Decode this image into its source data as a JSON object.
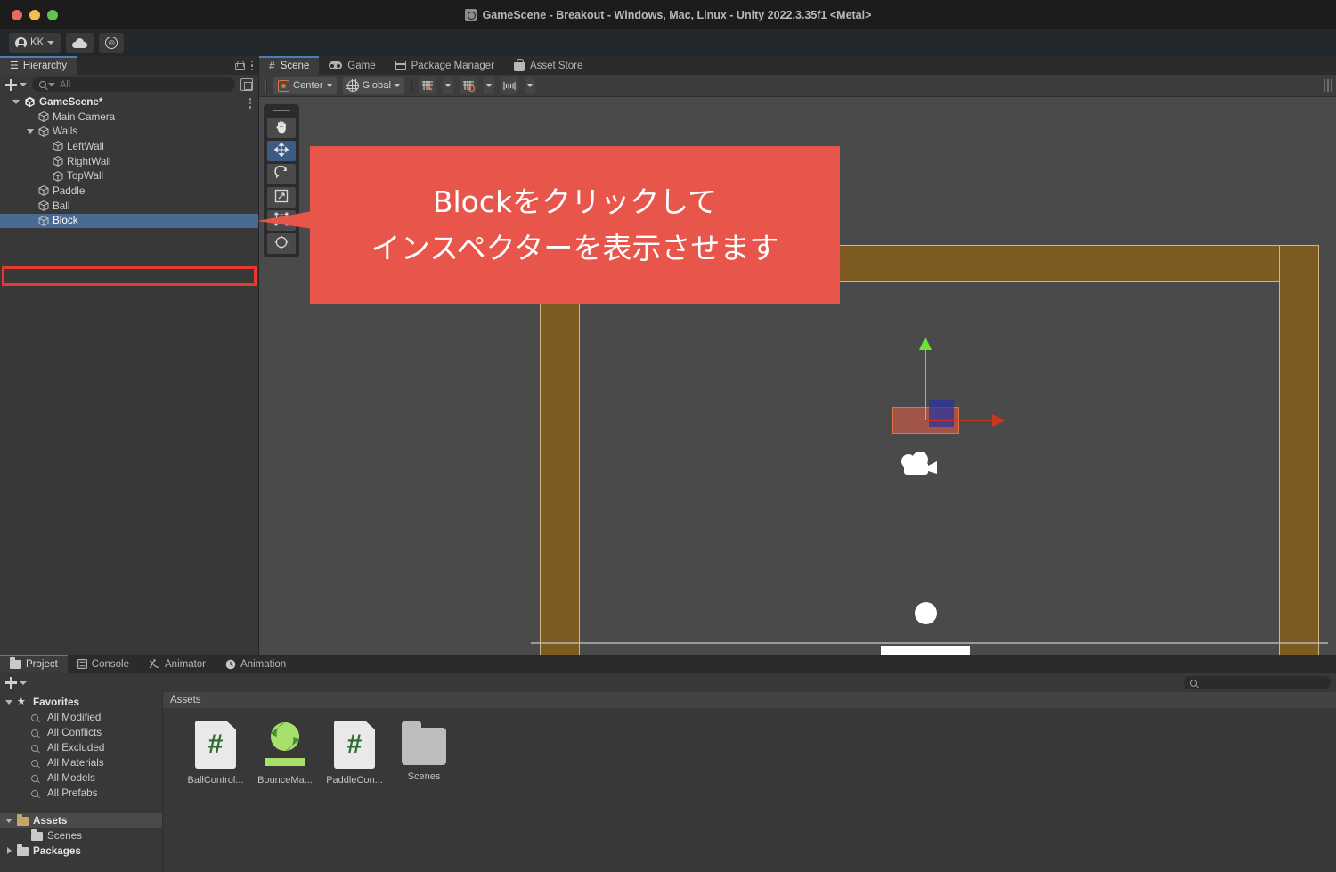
{
  "window": {
    "title": "GameScene - Breakout - Windows, Mac, Linux - Unity 2022.3.35f1 <Metal>",
    "title_icon": "unity-scene-icon",
    "traffic_lights": [
      "close",
      "minimize",
      "maximize"
    ]
  },
  "toolbar": {
    "account_label": "KK",
    "account_icon": "person-icon",
    "cloud_icon": "cloud-icon",
    "services_icon": "unity-services-icon",
    "services_glyph": "◎",
    "play_label": "play-icon",
    "pause_label": "pause-icon",
    "step_label": "step-icon"
  },
  "hierarchy": {
    "tab_label": "Hierarchy",
    "tab_icon": "hierarchy-icon",
    "lock_icon": "lock-icon",
    "menu_icon": "kebab-menu-icon",
    "add_label": "+",
    "search_placeholder": "All",
    "search_value": "",
    "search_icon": "search-icon",
    "popout_icon": "popout-icon",
    "items": [
      {
        "label": "GameScene*",
        "depth": 0,
        "expanded": true,
        "icon": "unity-logo-icon",
        "selected": false
      },
      {
        "label": "Main Camera",
        "depth": 1,
        "expanded": null,
        "icon": "gameobject-cube-icon",
        "selected": false
      },
      {
        "label": "Walls",
        "depth": 1,
        "expanded": true,
        "icon": "gameobject-cube-icon",
        "selected": false
      },
      {
        "label": "LeftWall",
        "depth": 2,
        "expanded": null,
        "icon": "gameobject-cube-icon",
        "selected": false
      },
      {
        "label": "RightWall",
        "depth": 2,
        "expanded": null,
        "icon": "gameobject-cube-icon",
        "selected": false
      },
      {
        "label": "TopWall",
        "depth": 2,
        "expanded": null,
        "icon": "gameobject-cube-icon",
        "selected": false
      },
      {
        "label": "Paddle",
        "depth": 1,
        "expanded": null,
        "icon": "gameobject-cube-icon",
        "selected": false
      },
      {
        "label": "Ball",
        "depth": 1,
        "expanded": null,
        "icon": "gameobject-cube-icon",
        "selected": false
      },
      {
        "label": "Block",
        "depth": 1,
        "expanded": null,
        "icon": "gameobject-cube-icon",
        "selected": true
      }
    ]
  },
  "scene": {
    "tabs": [
      {
        "label": "Scene",
        "icon": "grid-hash-icon",
        "active": true
      },
      {
        "label": "Game",
        "icon": "gamepad-icon",
        "active": false
      },
      {
        "label": "Package Manager",
        "icon": "package-icon",
        "active": false
      },
      {
        "label": "Asset Store",
        "icon": "store-bag-icon",
        "active": false
      }
    ],
    "toolbar": {
      "pivot_label": "Center",
      "pivot_icon": "pivot-center-icon",
      "handle_label": "Global",
      "handle_icon": "globe-icon",
      "grid_snap_icon": "grid-snap-icon",
      "snap_increment_icon": "snap-increment-icon",
      "align_icon": "align-icon",
      "dropdown_icon": "chevron-down-icon",
      "resize_handle_icon": "resize-handle-icon"
    },
    "tools": [
      {
        "name": "hand-tool",
        "icon": "hand-icon",
        "active": false
      },
      {
        "name": "move-tool",
        "icon": "move-arrows-icon",
        "active": true
      },
      {
        "name": "rotate-tool",
        "icon": "rotate-icon",
        "active": false
      },
      {
        "name": "scale-tool",
        "icon": "scale-icon",
        "active": false
      },
      {
        "name": "rect-tool",
        "icon": "rect-transform-icon",
        "active": false
      },
      {
        "name": "transform-tool",
        "icon": "transform-icon",
        "active": false
      }
    ],
    "objects": {
      "wall_color": "#7c5a20",
      "wall_outline": "#cbb98a",
      "ball_color": "#ffffff",
      "paddle_color": "#ffffff",
      "block_fill": "#d65e48",
      "block_outline": "#e2743f",
      "gizmo_y_color": "#6ee03a",
      "gizmo_x_color": "#c9361f",
      "camera_gizmo_icon": "camera-gizmo-icon",
      "background": "#4a4a4a"
    }
  },
  "callout": {
    "line1": "Blockをクリックして",
    "line2": "インスペクターを表示させます",
    "background": "#e8564b",
    "text_color": "#ffffff",
    "highlight_color": "#e8372c"
  },
  "project": {
    "tabs": [
      {
        "label": "Project",
        "icon": "folder-icon",
        "active": true
      },
      {
        "label": "Console",
        "icon": "console-icon",
        "active": false
      },
      {
        "label": "Animator",
        "icon": "animator-icon",
        "active": false
      },
      {
        "label": "Animation",
        "icon": "animation-clock-icon",
        "active": false
      }
    ],
    "add_label": "+",
    "search_placeholder": "",
    "search_value": "",
    "search_icon": "search-icon",
    "tree": [
      {
        "label": "Favorites",
        "depth": 0,
        "icon": "star-icon",
        "expanded": true,
        "bold": true,
        "highlight": false
      },
      {
        "label": "All Modified",
        "depth": 1,
        "icon": "search-icon",
        "expanded": null,
        "bold": false,
        "highlight": false
      },
      {
        "label": "All Conflicts",
        "depth": 1,
        "icon": "search-icon",
        "expanded": null,
        "bold": false,
        "highlight": false
      },
      {
        "label": "All Excluded",
        "depth": 1,
        "icon": "search-icon",
        "expanded": null,
        "bold": false,
        "highlight": false
      },
      {
        "label": "All Materials",
        "depth": 1,
        "icon": "search-icon",
        "expanded": null,
        "bold": false,
        "highlight": false
      },
      {
        "label": "All Models",
        "depth": 1,
        "icon": "search-icon",
        "expanded": null,
        "bold": false,
        "highlight": false
      },
      {
        "label": "All Prefabs",
        "depth": 1,
        "icon": "search-icon",
        "expanded": null,
        "bold": false,
        "highlight": false
      },
      {
        "label": "Assets",
        "depth": 0,
        "icon": "folder-open-icon",
        "expanded": true,
        "bold": true,
        "highlight": true
      },
      {
        "label": "Scenes",
        "depth": 1,
        "icon": "folder-icon",
        "expanded": null,
        "bold": false,
        "highlight": false
      },
      {
        "label": "Packages",
        "depth": 0,
        "icon": "folder-icon",
        "expanded": false,
        "bold": true,
        "highlight": false
      }
    ],
    "breadcrumb": "Assets",
    "assets": [
      {
        "label": "BallControl...",
        "icon": "csharp-script-icon",
        "glyph": "#"
      },
      {
        "label": "BounceMa...",
        "icon": "material-icon",
        "glyph": ""
      },
      {
        "label": "PaddleCon...",
        "icon": "csharp-script-icon",
        "glyph": "#"
      },
      {
        "label": "Scenes",
        "icon": "folder-icon",
        "glyph": ""
      }
    ]
  }
}
